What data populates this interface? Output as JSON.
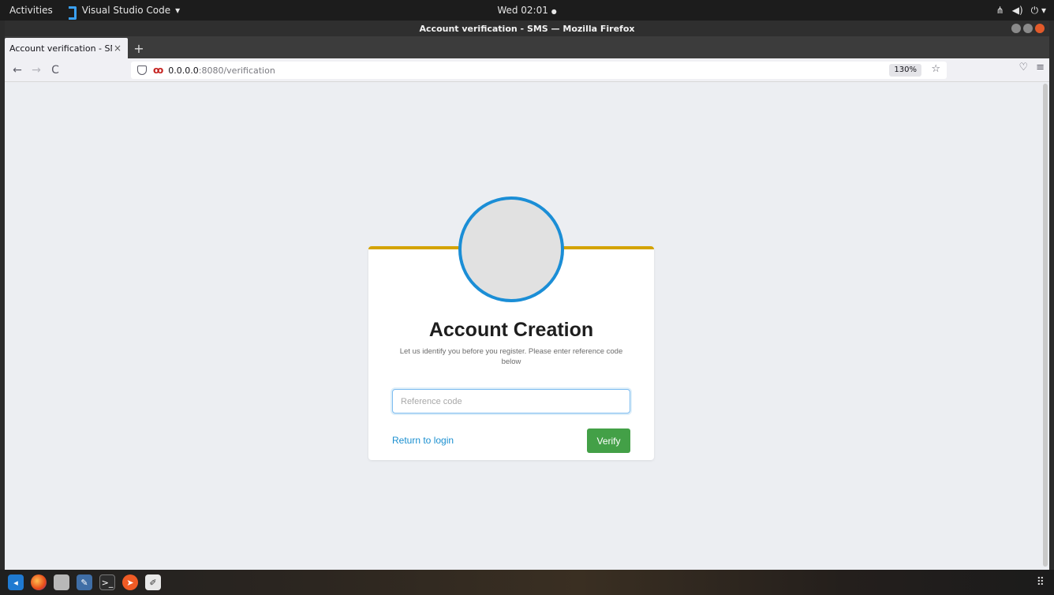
{
  "topbar": {
    "activities": "Activities",
    "app_menu": "Visual Studio Code",
    "app_menu_caret": "▾",
    "clock": "Wed 02:01",
    "clock_dot": "●",
    "status_icons": [
      "network-icon",
      "volume-icon",
      "power-icon"
    ]
  },
  "window": {
    "title": "Account verification - SMS — Mozilla Firefox"
  },
  "tabs": [
    {
      "title": "Account verification - SMS",
      "close": "×"
    }
  ],
  "newtab_label": "+",
  "navbar": {
    "back": "←",
    "forward": "→",
    "reload": "C",
    "url_host": "0.0.0.0",
    "url_rest": ":8080/verification",
    "zoom": "130%",
    "star": "☆",
    "pocket": "♡",
    "menu": "≡"
  },
  "page": {
    "title": "Account Creation",
    "subtitle": "Let us identify you before you register. Please enter reference code below",
    "input_placeholder": "Reference code",
    "input_value": "",
    "return_link": "Return to login",
    "verify_button": "Verify"
  },
  "colors": {
    "card_accent": "#d4a300",
    "avatar_ring": "#1b8ed6",
    "verify_button": "#43a047",
    "link": "#1a8fd0"
  },
  "dock": {
    "icons": [
      "vscode-icon",
      "firefox-icon",
      "files-icon",
      "editor-icon",
      "terminal-icon",
      "postman-icon",
      "text-editor-icon"
    ],
    "apps_grid": "⠿"
  }
}
